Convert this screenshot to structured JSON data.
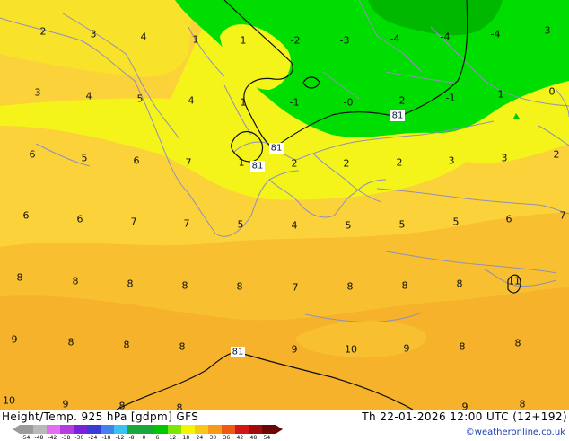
{
  "header": {
    "title": "Height/Temp. 925 hPa [gdpm] GFS",
    "timestamp": "Th 22-01-2026 12:00 UTC (12+192)",
    "credit": "©weatheronline.co.uk"
  },
  "legend": {
    "ticks": [
      "-54",
      "-48",
      "-42",
      "-38",
      "-30",
      "-24",
      "-18",
      "-12",
      "-8",
      "0",
      "6",
      "12",
      "18",
      "24",
      "30",
      "36",
      "42",
      "48",
      "54"
    ],
    "colors": [
      "#9b9b9b",
      "#b9b9b9",
      "#e36ef0",
      "#b43ce0",
      "#7a22d8",
      "#3a3ad8",
      "#3f82f0",
      "#38c4f0",
      "#18a83c",
      "#18a83c",
      "#00c800",
      "#7ee600",
      "#f5f500",
      "#f8c818",
      "#f89a18",
      "#f05a10",
      "#d01818",
      "#a00c0c",
      "#6a0808"
    ]
  },
  "field_colors": {
    "warm_yellow": "#fcd23a",
    "orange": "#f8c030",
    "deep_orange": "#f6b22a",
    "bright_yellow": "#f4f41a",
    "green": "#00dd00",
    "dark_green": "#00b800",
    "coast": "#9090b8",
    "contour": "#101010"
  },
  "temperature_labels": [
    "2",
    "3",
    "4",
    "-1",
    "1",
    "-2",
    "-3",
    "-4",
    "-4",
    "-4",
    "-3",
    "3",
    "4",
    "5",
    "4",
    "1",
    "-1",
    "-0",
    "-2",
    "-1",
    "1",
    "0",
    "6",
    "5",
    "6",
    "7",
    "1",
    "2",
    "2",
    "2",
    "3",
    "3",
    "2",
    "6",
    "6",
    "7",
    "7",
    "5",
    "4",
    "5",
    "5",
    "5",
    "6",
    "7",
    "8",
    "8",
    "8",
    "8",
    "8",
    "7",
    "8",
    "8",
    "8",
    "11",
    "9",
    "8",
    "8",
    "8",
    "9",
    "10",
    "9",
    "8",
    "8",
    "10",
    "9",
    "8",
    "8",
    "9",
    "8"
  ],
  "height_labels": [
    "81",
    "81",
    "81",
    "81"
  ]
}
